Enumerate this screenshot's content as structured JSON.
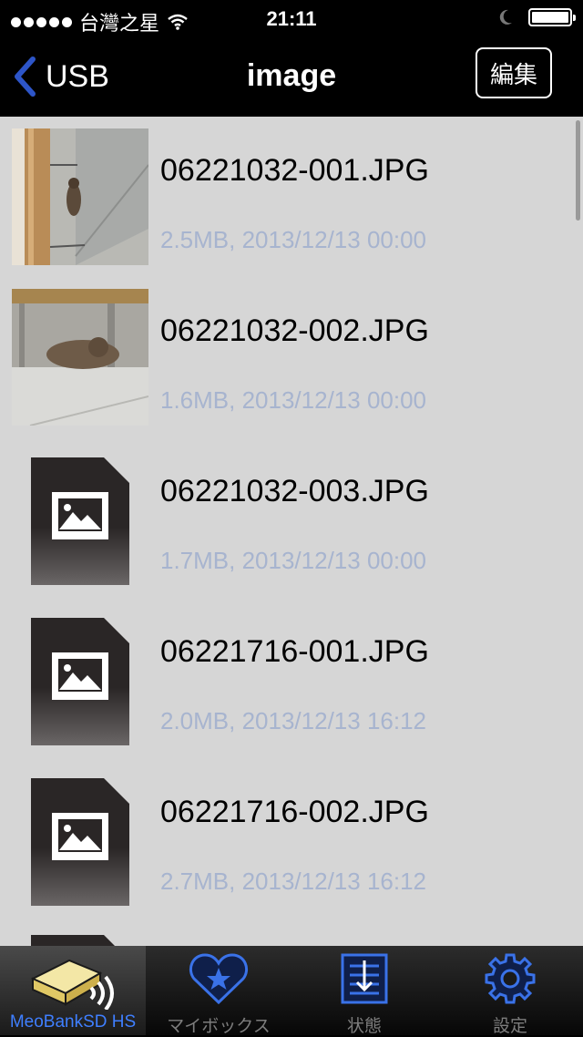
{
  "status_bar": {
    "carrier": "台灣之星",
    "time": "21:11",
    "signal_bars": 5,
    "battery_level": 1.0
  },
  "nav": {
    "back_label": "USB",
    "title": "image",
    "edit_label": "編集"
  },
  "files": [
    {
      "name": "06221032-001.JPG",
      "meta": "2.5MB, 2013/12/13 00:00",
      "thumb": "photo-cat-on-ledge"
    },
    {
      "name": "06221032-002.JPG",
      "meta": "1.6MB, 2013/12/13 00:00",
      "thumb": "photo-cat-sleeping"
    },
    {
      "name": "06221032-003.JPG",
      "meta": "1.7MB, 2013/12/13 00:00",
      "thumb": "image-file-icon"
    },
    {
      "name": "06221716-001.JPG",
      "meta": "2.0MB, 2013/12/13 16:12",
      "thumb": "image-file-icon"
    },
    {
      "name": "06221716-002.JPG",
      "meta": "2.7MB, 2013/12/13 16:12",
      "thumb": "image-file-icon"
    },
    {
      "name": "",
      "meta": "",
      "thumb": "image-file-icon"
    }
  ],
  "tabs": [
    {
      "label": "MeoBankSD HS",
      "icon": "device-wifi-icon",
      "active": true
    },
    {
      "label": "マイボックス",
      "icon": "heart-star-icon",
      "active": false
    },
    {
      "label": "状態",
      "icon": "status-doc-icon",
      "active": false
    },
    {
      "label": "設定",
      "icon": "gear-icon",
      "active": false
    }
  ],
  "colors": {
    "meta_text": "#a7b4cf",
    "list_bg": "#d6d6d6",
    "active_tab": "#3f7fff",
    "back_chevron": "#2d55c8"
  }
}
